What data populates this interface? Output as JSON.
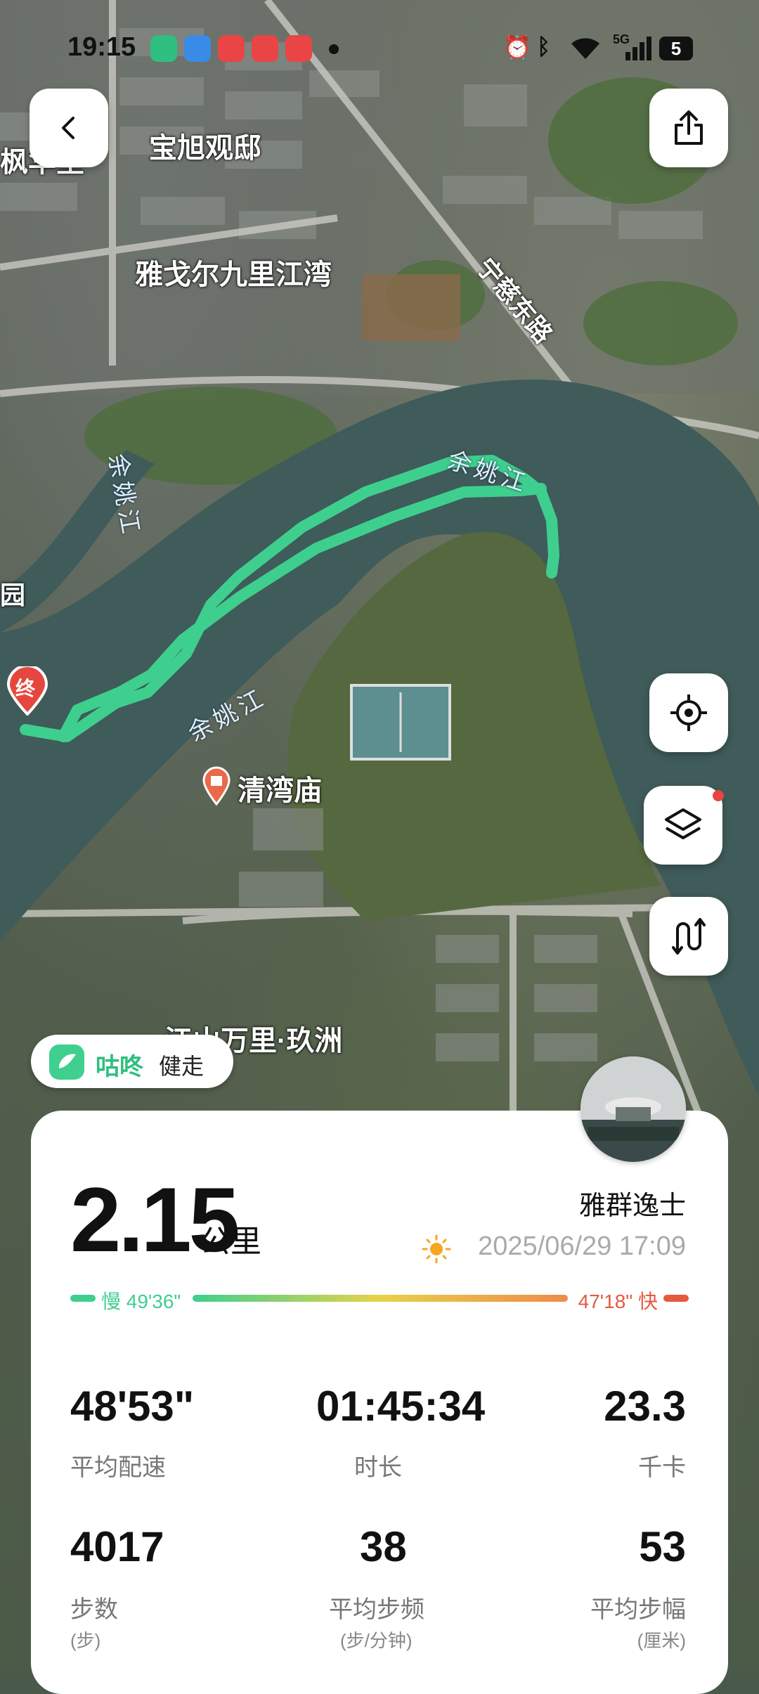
{
  "status_bar": {
    "time": "19:15",
    "network": "5G",
    "battery": "5"
  },
  "map": {
    "labels": {
      "top_left_cut": "枫华里",
      "baoxu": "宝旭观邸",
      "yage": "雅戈尔九里江湾",
      "ningci": "宁慈东路",
      "yuyao_left": "余姚江",
      "yuyao_top": "余姚江",
      "yuyao_center": "余姚江",
      "qingwan": "清湾庙",
      "jiangshan": "江山万里·玖洲",
      "yuan": "园"
    },
    "end_pin": "终"
  },
  "brand": {
    "name": "咕咚",
    "sub": "健走"
  },
  "summary": {
    "distance": "2.15",
    "distance_unit": "公里",
    "username": "雅群逸士",
    "datetime": "2025/06/29 17:09",
    "pace_slow": "慢 49'36\"",
    "pace_fast": "47'18\" 快"
  },
  "stats": [
    {
      "value": "48'53\"",
      "label": "平均配速",
      "sub": ""
    },
    {
      "value": "01:45:34",
      "label": "时长",
      "sub": ""
    },
    {
      "value": "23.3",
      "label": "千卡",
      "sub": ""
    },
    {
      "value": "4017",
      "label": "步数",
      "sub": "(步)"
    },
    {
      "value": "38",
      "label": "平均步频",
      "sub": "(步/分钟)"
    },
    {
      "value": "53",
      "label": "平均步幅",
      "sub": "(厘米)"
    }
  ],
  "colors": {
    "route": "#3ecf8e",
    "end_pin": "#e5473f",
    "pace_slow": "#3ecf8e",
    "pace_fast": "#e5593f"
  }
}
